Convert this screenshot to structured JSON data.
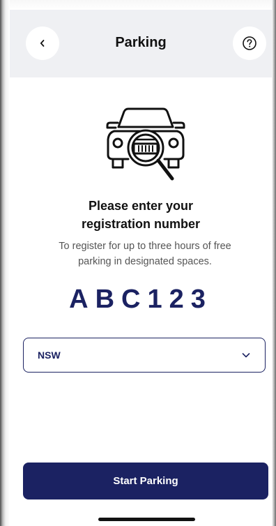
{
  "header": {
    "title": "Parking",
    "back_icon": "chevron-left-icon",
    "help_icon": "question-circle-icon"
  },
  "illustration": {
    "icon": "car-magnifier-icon"
  },
  "main": {
    "heading_line1": "Please enter your",
    "heading_line2": "registration number",
    "subtext_line1": "To register for up to three hours of free",
    "subtext_line2": "parking in designated spaces.",
    "plate": "ABC123"
  },
  "state_select": {
    "value": "NSW",
    "icon": "chevron-down-icon"
  },
  "footer": {
    "start_label": "Start Parking"
  },
  "colors": {
    "brand": "#1b2262",
    "header_bg": "#eff0f3",
    "text": "#111111",
    "muted": "#555555"
  }
}
